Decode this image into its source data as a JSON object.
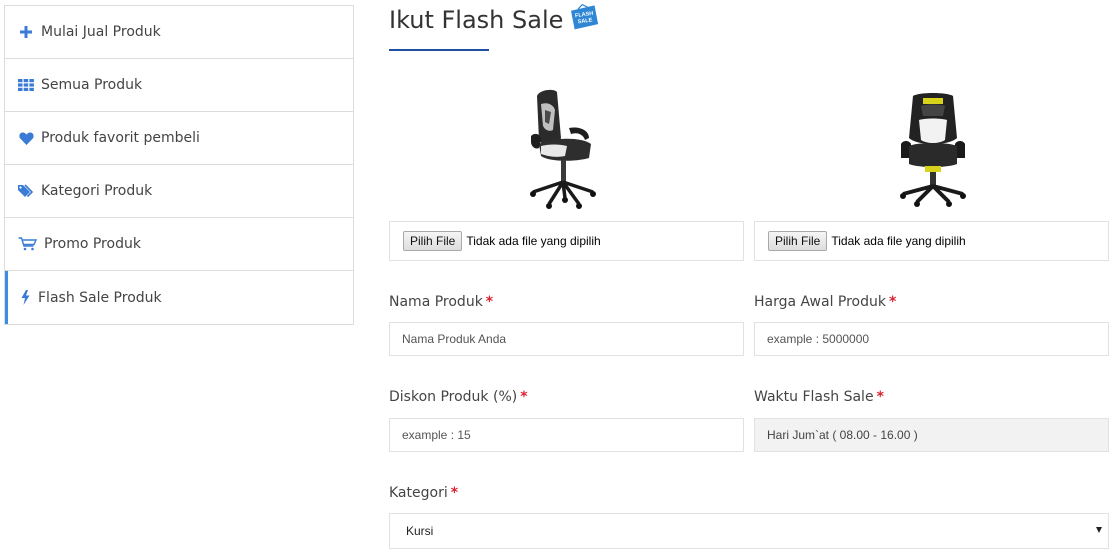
{
  "sidebar": {
    "items": [
      {
        "label": "Mulai Jual Produk",
        "icon": "plus-icon"
      },
      {
        "label": "Semua Produk",
        "icon": "grid-icon"
      },
      {
        "label": "Produk favorit pembeli",
        "icon": "heart-icon"
      },
      {
        "label": "Kategori Produk",
        "icon": "tags-icon"
      },
      {
        "label": "Promo Produk",
        "icon": "cart-icon"
      },
      {
        "label": "Flash Sale Produk",
        "icon": "bolt-icon",
        "active": true
      }
    ],
    "icon_color": "#3a7bd5",
    "active_color": "#3a8ee0"
  },
  "page": {
    "title": "Ikut Flash Sale",
    "badge_text_line1": "FLASH",
    "badge_text_line2": "SALE"
  },
  "uploads": [
    {
      "button": "Pilih File",
      "status": "Tidak ada file yang dipilih"
    },
    {
      "button": "Pilih File",
      "status": "Tidak ada file yang dipilih"
    }
  ],
  "form": {
    "nama_produk": {
      "label": "Nama Produk",
      "placeholder": "Nama Produk Anda",
      "required": "*"
    },
    "harga_awal": {
      "label": "Harga Awal Produk",
      "placeholder": "example : 5000000",
      "required": "*"
    },
    "diskon": {
      "label": "Diskon Produk (%)",
      "placeholder": "example : 15",
      "required": "*"
    },
    "waktu": {
      "label": "Waktu Flash Sale",
      "value": "Hari Jum`at ( 08.00 - 16.00 )",
      "required": "*"
    },
    "kategori": {
      "label": "Kategori",
      "selected": "Kursi",
      "required": "*"
    }
  }
}
